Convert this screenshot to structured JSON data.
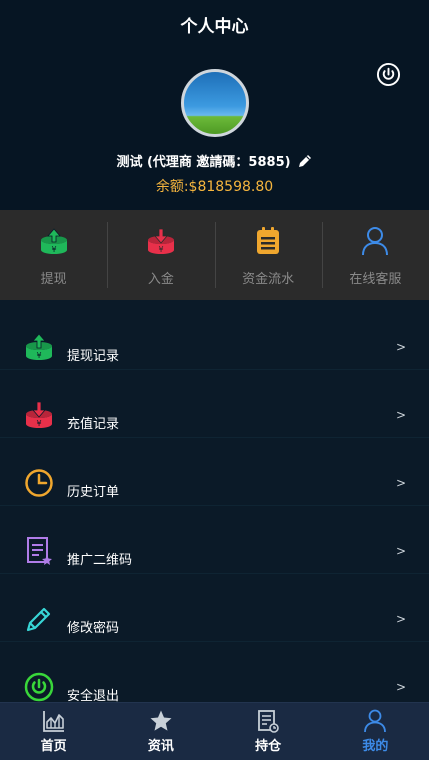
{
  "header": {
    "title": "个人中心",
    "username": "测试 (代理商 邀請碼：5885)",
    "balance": "余额:$818598.80"
  },
  "quick_actions": [
    {
      "label": "提现",
      "icon": "withdraw-icon",
      "color": "#1fb85a"
    },
    {
      "label": "入金",
      "icon": "deposit-icon",
      "color": "#e8304a"
    },
    {
      "label": "资金流水",
      "icon": "fund-flow-icon",
      "color": "#f0a72e"
    },
    {
      "label": "在线客服",
      "icon": "customer-service-icon",
      "color": "#3d8be8"
    }
  ],
  "menu": [
    {
      "label": "提现记录",
      "icon": "withdraw-record-icon",
      "arrow": ">"
    },
    {
      "label": "充值记录",
      "icon": "recharge-record-icon",
      "arrow": ">"
    },
    {
      "label": "历史订单",
      "icon": "clock-icon",
      "arrow": ">"
    },
    {
      "label": "推广二维码",
      "icon": "document-star-icon",
      "arrow": ">"
    },
    {
      "label": "修改密码",
      "icon": "pencil-icon",
      "arrow": ">"
    },
    {
      "label": "安全退出",
      "icon": "power-icon",
      "arrow": ">"
    }
  ],
  "tabs": [
    {
      "label": "首页",
      "icon": "chart-icon"
    },
    {
      "label": "资讯",
      "icon": "star-icon"
    },
    {
      "label": "持仓",
      "icon": "ledger-icon"
    },
    {
      "label": "我的",
      "icon": "user-icon",
      "active": true
    }
  ],
  "colors": {
    "accent_gold": "#f5b53e",
    "active_blue": "#3d8be8",
    "green": "#1fb85a",
    "red": "#e8304a",
    "purple": "#b07ce8",
    "cyan": "#38d6d6",
    "lime": "#39d63a"
  }
}
